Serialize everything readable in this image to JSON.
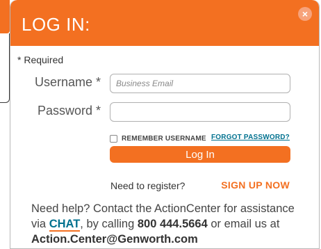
{
  "modal": {
    "title": "LOG IN:",
    "close_symbol": "×",
    "required_note": "* Required"
  },
  "form": {
    "username_label": "Username *",
    "username_placeholder": "Business Email",
    "password_label": "Password *",
    "password_value": "",
    "remember_label": "REMEMBER USERNAME",
    "forgot_label": "FORGOT PASSWORD?",
    "login_button": "Log In"
  },
  "register": {
    "prompt": "Need to register?",
    "signup_label": "SIGN UP NOW"
  },
  "help": {
    "line_intro": "Need help? Contact the ActionCenter for assistance via ",
    "chat_label": "CHAT",
    "line_mid": ", by calling ",
    "phone": "800 444.5664",
    "line_or": " or email us at ",
    "email": "Action.Center@Genworth.com"
  },
  "colors": {
    "brand_orange": "#f37021",
    "link_teal": "#00718f"
  },
  "icons": {
    "close": "close-icon",
    "checkbox": "checkbox-icon"
  }
}
